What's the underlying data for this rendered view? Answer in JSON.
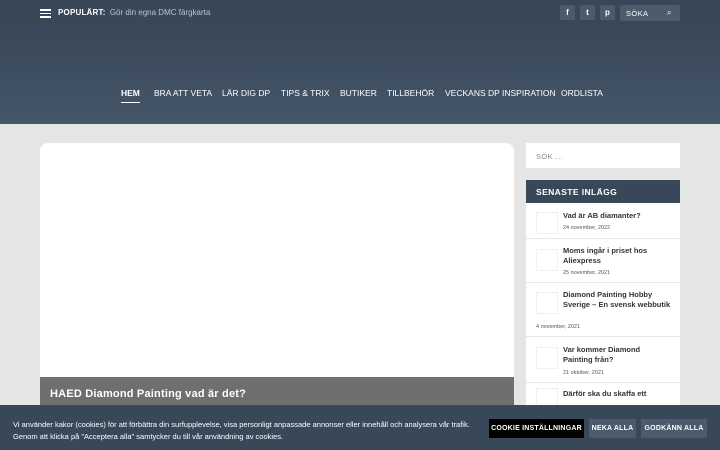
{
  "topbar": {
    "popular_label": "POPULÄRT:",
    "popular_link": "Gör din egna DMC färgkarta",
    "social": [
      {
        "icon": "facebook-icon",
        "glyph": "f"
      },
      {
        "icon": "twitter-icon",
        "glyph": "t"
      },
      {
        "icon": "pinterest-icon",
        "glyph": "p"
      }
    ],
    "search_placeholder": "SÖKA",
    "search_glyph": "⌕"
  },
  "nav": {
    "items": [
      "HEM",
      "BRA ATT VETA",
      "LÄR DIG DP",
      "TIPS & TRIX",
      "BUTIKER",
      "TILLBEHÖR",
      "VECKANS DP INSPIRATION",
      "ORDLISTA"
    ],
    "active_index": 0
  },
  "featured": {
    "title": "HAED Diamond Painting vad är det?"
  },
  "sidebar": {
    "search_placeholder": "SÖK ...",
    "widget_title": "SENASTE INLÄGG",
    "posts": [
      {
        "title": "Vad är AB diamanter?",
        "date": "24 november, 2022"
      },
      {
        "title": "Moms ingår i priset hos Aliexpress",
        "date": "25 november, 2021"
      },
      {
        "title": "Diamond Painting Hobby Sverige – En svensk webbutik",
        "date": "4 november, 2021"
      },
      {
        "title": "Var kommer Diamond Painting från?",
        "date": "21 oktober, 2021"
      },
      {
        "title": "Därför ska du skaffa ett",
        "date": ""
      }
    ]
  },
  "cookie": {
    "line1": "Vi använder kakor (cookies) för att förbättra din surfupplevelse, visa personligt anpassade annonser eller innehåll och analysera vår trafik.",
    "line2": "Genom att klicka på \"Acceptera alla\" samtycker du till vår användning av cookies.",
    "settings_label": "COOKIE INSTÄLLNINGAR",
    "reject_label": "NEKA ALLA",
    "accept_label": "GODKÄNN ALLA"
  },
  "colors": {
    "header_bg": "#384859",
    "page_bg": "#e5e5e5",
    "cookie_settings_btn": "#000000",
    "cookie_action_btn": "#4a5b6c"
  }
}
